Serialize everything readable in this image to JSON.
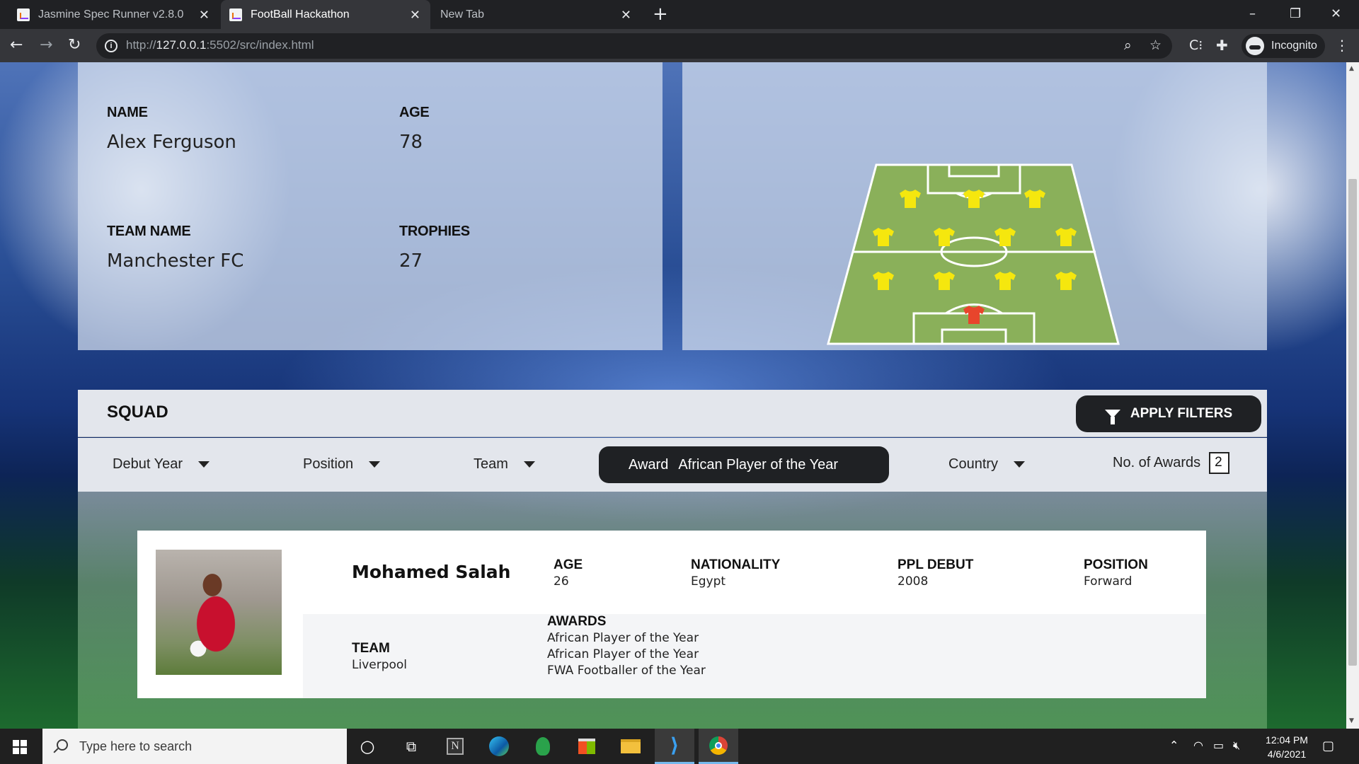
{
  "browser": {
    "tabs": [
      {
        "title": "Jasmine Spec Runner v2.8.0"
      },
      {
        "title": "FootBall Hackathon"
      },
      {
        "title": "New Tab"
      }
    ],
    "url_scheme": "http://",
    "url_host": "127.0.0.1",
    "url_rest": ":5502/src/index.html",
    "profile_label": "Incognito"
  },
  "manager": {
    "name_label": "NAME",
    "name": "Alex Ferguson",
    "age_label": "AGE",
    "age": "78",
    "team_label": "TEAM NAME",
    "team": "Manchester FC",
    "trophies_label": "TROPHIES",
    "trophies": "27"
  },
  "formation": {
    "pitch_color": "#8ab05a",
    "outfield_shirt_color": "#f5e70e",
    "goalkeeper_shirt_color": "#e8452c"
  },
  "squad": {
    "title": "SQUAD",
    "apply_label": "APPLY FILTERS",
    "filters": {
      "debut_year": "Debut Year",
      "position": "Position",
      "team": "Team",
      "award_label": "Award",
      "award_value": "African Player of the Year",
      "country": "Country",
      "num_awards_label": "No. of Awards",
      "num_awards_value": "2"
    },
    "players": [
      {
        "name": "Mohamed Salah",
        "age_label": "AGE",
        "age": "26",
        "nationality_label": "NATIONALITY",
        "nationality": "Egypt",
        "debut_label": "PPL DEBUT",
        "debut": "2008",
        "position_label": "POSITION",
        "position": "Forward",
        "team_label": "TEAM",
        "team": "Liverpool",
        "awards_label": "AWARDS",
        "awards": [
          "African Player of the Year",
          "African Player of the Year",
          "FWA Footballer of the Year"
        ]
      }
    ]
  },
  "taskbar": {
    "search_placeholder": "Type here to search",
    "time": "12:04 PM",
    "date": "4/6/2021",
    "apps": [
      "cortana-icon",
      "task-view-icon",
      "notion-icon",
      "edge-icon",
      "app-icon",
      "store-icon",
      "file-explorer-icon",
      "vscode-icon",
      "chrome-icon"
    ]
  }
}
